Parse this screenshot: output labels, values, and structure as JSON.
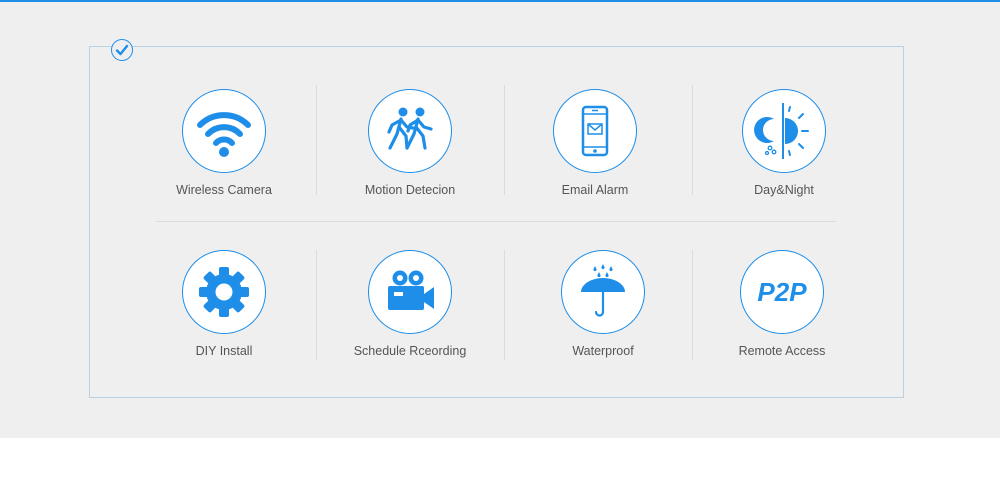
{
  "features": [
    {
      "label": "Wireless Camera",
      "icon": "wifi-icon"
    },
    {
      "label": "Motion Detecion",
      "icon": "walking-people-icon"
    },
    {
      "label": "Email Alarm",
      "icon": "phone-email-icon"
    },
    {
      "label": "Day&Night",
      "icon": "day-night-icon"
    },
    {
      "label": "DIY Install",
      "icon": "gear-icon"
    },
    {
      "label": "Schedule Rceording",
      "icon": "video-camera-icon"
    },
    {
      "label": "Waterproof",
      "icon": "umbrella-rain-icon"
    },
    {
      "label": "Remote Access",
      "icon": "p2p-icon",
      "icon_text": "P2P"
    }
  ],
  "colors": {
    "accent": "#1e8ee8",
    "background": "#efefef",
    "text": "#555555",
    "border": "#b7d2e4"
  }
}
